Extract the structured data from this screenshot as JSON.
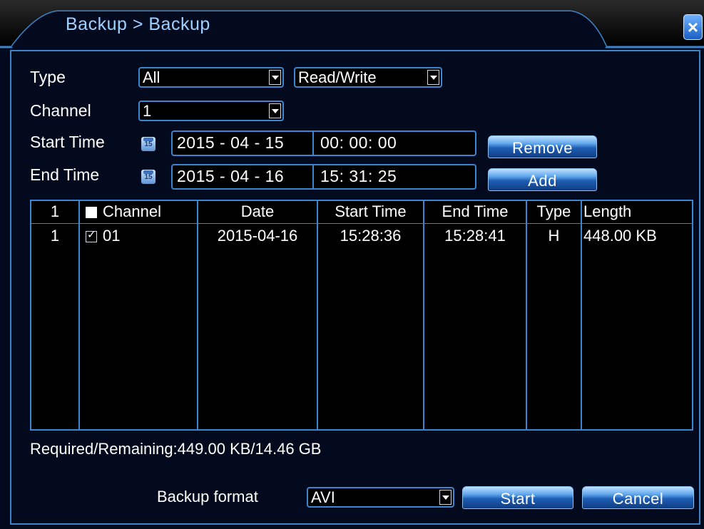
{
  "window": {
    "title": "Backup > Backup",
    "close_label": "×"
  },
  "filters": {
    "type_label": "Type",
    "type_value": "All",
    "mode_value": "Read/Write",
    "channel_label": "Channel",
    "channel_value": "1",
    "start_label": "Start Time",
    "start_date": "2015 - 04 - 15",
    "start_time": "00: 00: 00",
    "end_label": "End Time",
    "end_date": "2015 - 04 - 16",
    "end_time": "15: 31: 25",
    "calendar_icon": "15",
    "remove_label": "Remove",
    "add_label": "Add"
  },
  "table": {
    "headers": {
      "index": "1",
      "channel": "Channel",
      "date": "Date",
      "start": "Start Time",
      "end": "End Time",
      "type": "Type",
      "length": "Length"
    },
    "rows": [
      {
        "index": "1",
        "channel": "01",
        "date": "2015-04-16",
        "start": "15:28:36",
        "end": "15:28:41",
        "type": "H",
        "length": "448.00 KB",
        "checked": true
      }
    ]
  },
  "status": {
    "text": "Required/Remaining:449.00 KB/14.46 GB"
  },
  "footer": {
    "format_label": "Backup format",
    "format_value": "AVI",
    "start_label": "Start",
    "cancel_label": "Cancel"
  }
}
